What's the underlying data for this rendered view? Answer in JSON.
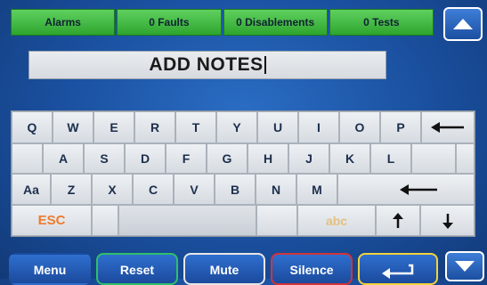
{
  "status_bar": {
    "alarms": "Alarms",
    "faults": "0 Faults",
    "disablements": "0 Disablements",
    "tests": "0 Tests"
  },
  "scroll": {
    "up_icon": "up-arrow-icon",
    "down_icon": "down-arrow-icon"
  },
  "note": {
    "value": "ADD NOTES"
  },
  "keyboard": {
    "row1": [
      "Q",
      "W",
      "E",
      "R",
      "T",
      "Y",
      "U",
      "I",
      "O",
      "P"
    ],
    "row2": [
      "A",
      "S",
      "D",
      "F",
      "G",
      "H",
      "J",
      "K",
      "L"
    ],
    "row3": [
      "Aa",
      "Z",
      "X",
      "C",
      "V",
      "B",
      "N",
      "M"
    ],
    "esc": "ESC",
    "abc": "abc",
    "backspace_icon": "backspace-arrow-icon",
    "enter_icon": "enter-arrow-icon",
    "up_icon": "up-arrow-icon",
    "down_icon": "down-arrow-icon"
  },
  "nav": {
    "menu": "Menu",
    "reset": "Reset",
    "mute": "Mute",
    "silence": "Silence",
    "return_icon": "return-arrow-icon"
  },
  "colors": {
    "status_green": "#3fbd3f",
    "reset_border": "#2fbf6a",
    "mute_border": "#e7e7e7",
    "silence_border": "#d0343a",
    "return_border": "#f4d23a",
    "esc_text": "#f07a2a",
    "abc_text": "#e3c07c"
  }
}
